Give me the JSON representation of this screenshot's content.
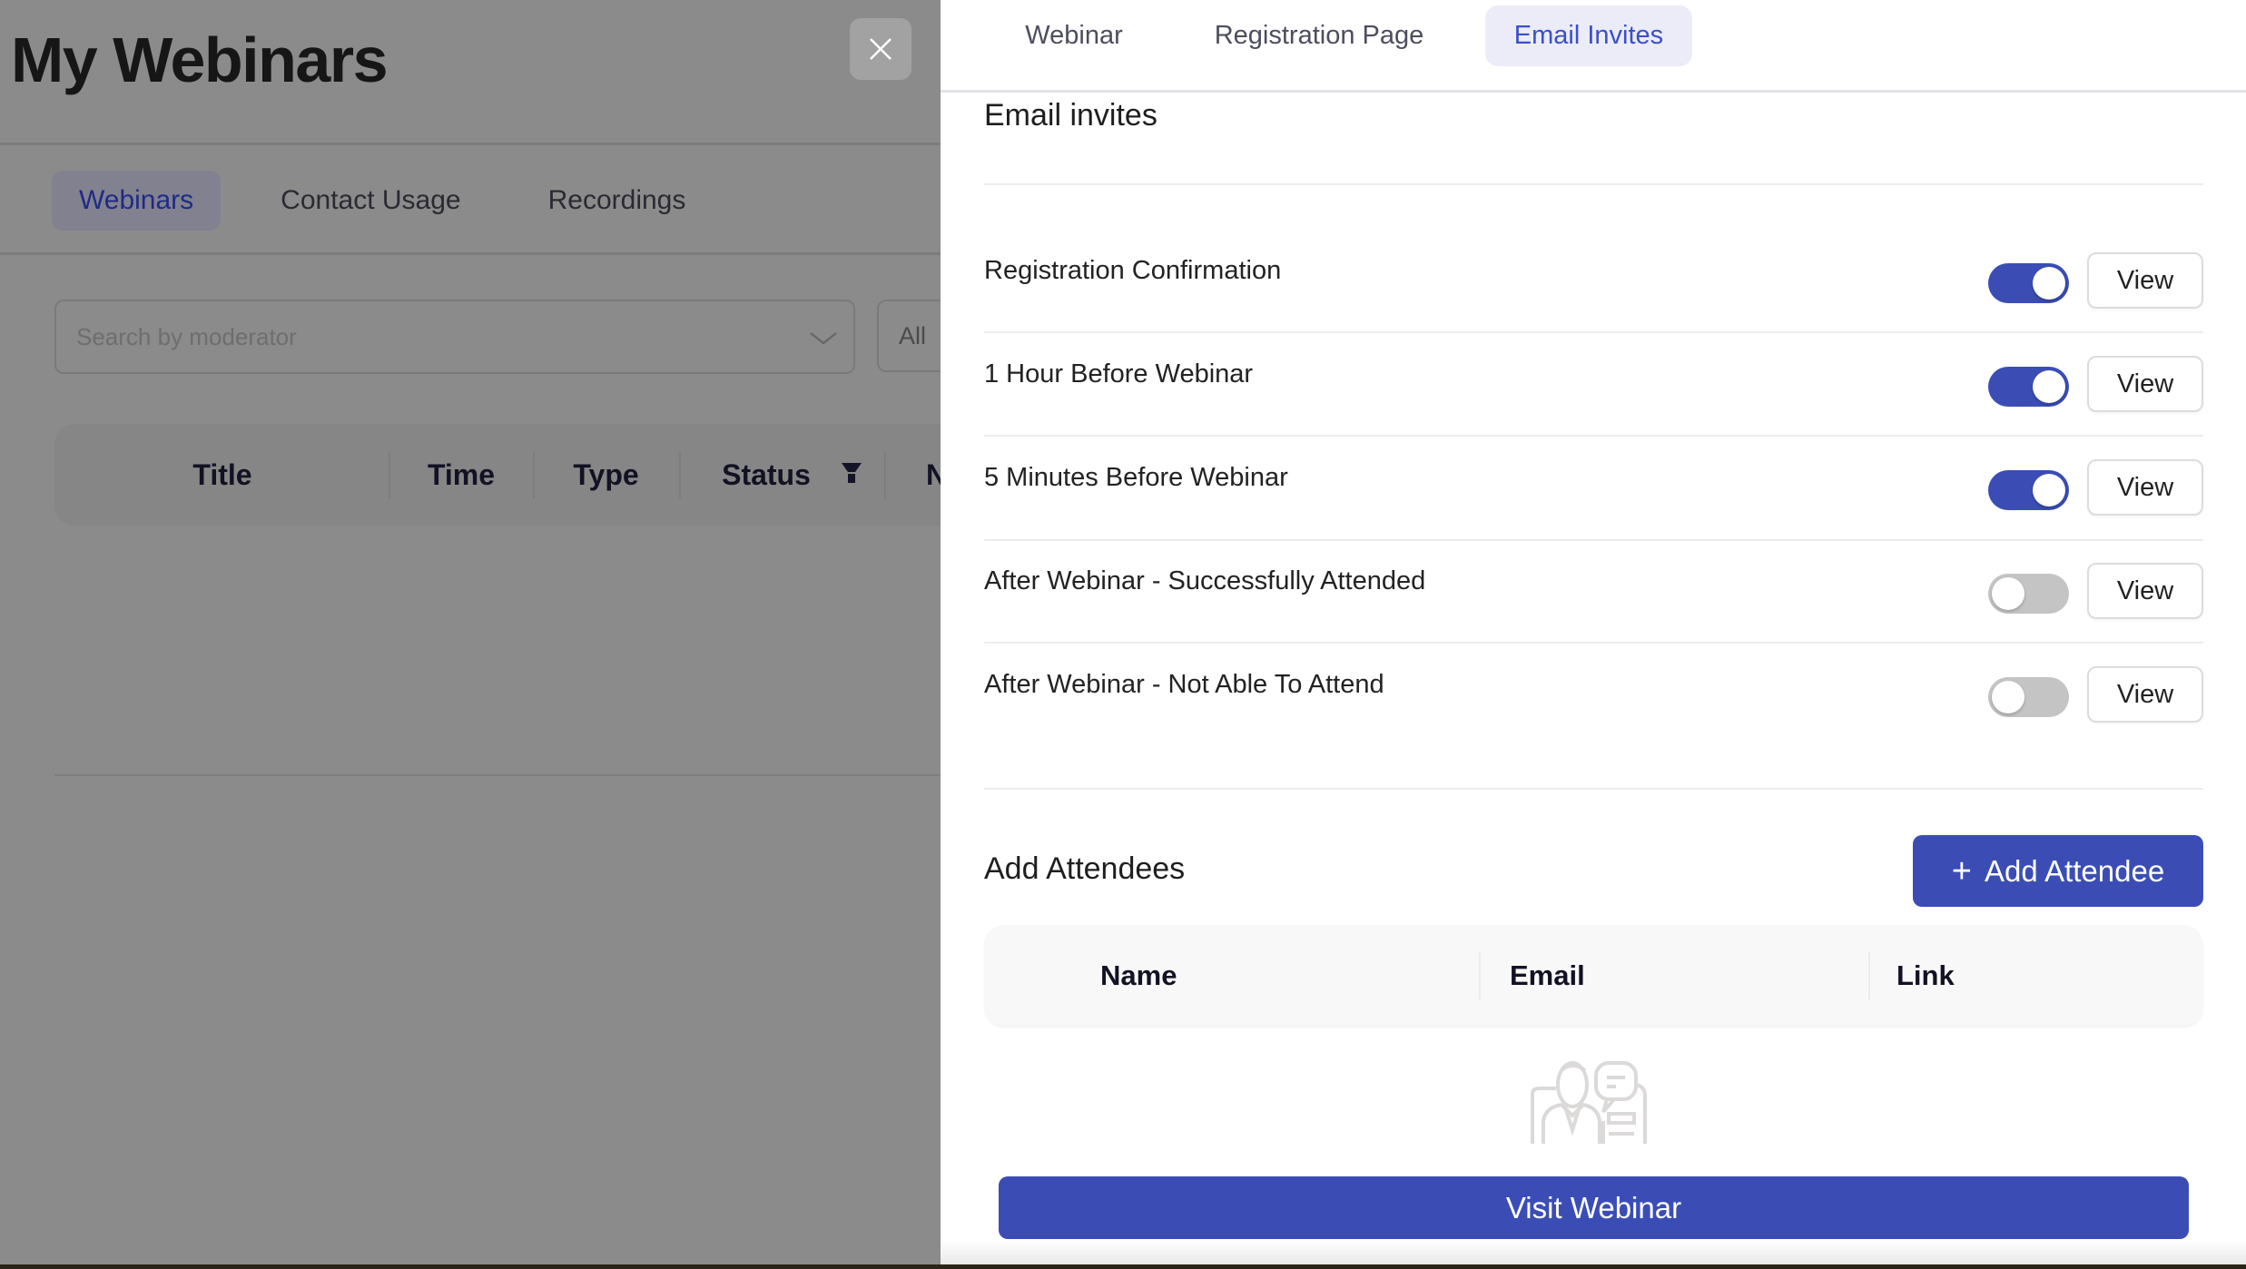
{
  "page": {
    "title": "My Webinars",
    "tabs": [
      {
        "label": "Webinars",
        "active": true
      },
      {
        "label": "Contact Usage",
        "active": false
      },
      {
        "label": "Recordings",
        "active": false
      }
    ],
    "search": {
      "placeholder": "Search by moderator"
    },
    "filter_select": {
      "value": "All"
    },
    "table": {
      "columns": [
        "Title",
        "Time",
        "Type",
        "Status",
        "N"
      ]
    }
  },
  "drawer": {
    "close_icon": "close-icon",
    "tabs": [
      {
        "label": "Webinar",
        "active": false
      },
      {
        "label": "Registration Page",
        "active": false
      },
      {
        "label": "Email Invites",
        "active": true
      }
    ],
    "email_invites": {
      "title": "Email invites",
      "items": [
        {
          "label": "Registration Confirmation",
          "enabled": true,
          "action": "View"
        },
        {
          "label": "1 Hour Before Webinar",
          "enabled": true,
          "action": "View"
        },
        {
          "label": "5 Minutes Before Webinar",
          "enabled": true,
          "action": "View"
        },
        {
          "label": "After Webinar - Successfully Attended",
          "enabled": false,
          "action": "View"
        },
        {
          "label": "After Webinar - Not Able To Attend",
          "enabled": false,
          "action": "View"
        }
      ]
    },
    "attendees": {
      "title": "Add Attendees",
      "add_button": "Add Attendee",
      "columns": [
        "Name",
        "Email",
        "Link"
      ],
      "empty_icon": "attendees-empty-icon"
    },
    "visit_button": "Visit Webinar"
  },
  "colors": {
    "accent": "#3b4db5",
    "active_tab_bg": "#ececf8",
    "active_tab_text": "#3b4fc8",
    "toggle_off": "#c4c4c4",
    "overlay": "#8b8b8b"
  }
}
